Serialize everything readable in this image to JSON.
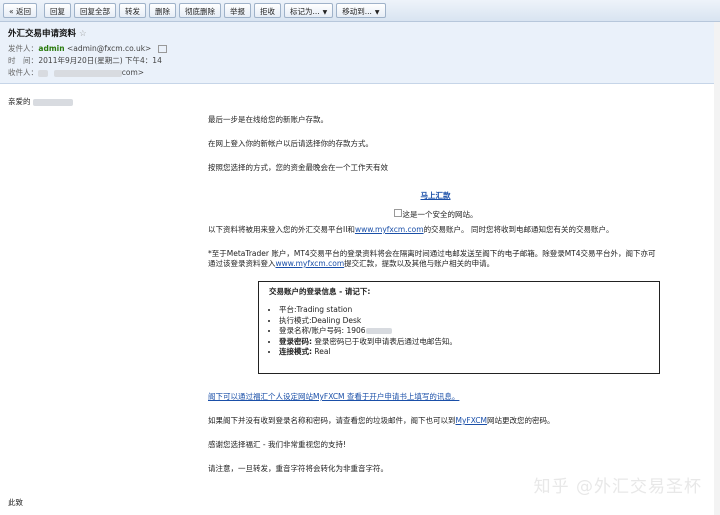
{
  "toolbar": {
    "back": "« 返回",
    "reply": "回复",
    "reply_all": "回复全部",
    "forward": "转发",
    "delete": "删除",
    "delete_perm": "彻底删除",
    "report": "举报",
    "reject": "拒收",
    "mark_as": "标记为...",
    "move_to": "移动到..."
  },
  "email": {
    "subject": "外汇交易申请资料",
    "labels": {
      "from": "发件人：",
      "time": "时　间：",
      "to": "收件人："
    },
    "from_name": "admin",
    "from_addr": "<admin@fxcm.co.uk>",
    "time": "2011年9月20日(星期二) 下午4：14",
    "to_suffix": "com>"
  },
  "body": {
    "greeting": "亲爱的",
    "p1": "最后一步是在线给您的新账户存款。",
    "p2": "在网上登入你的新帐户以后请选择你的存款方式。",
    "p3": "按照您选择的方式，您的资金最晚会在一个工作天有效",
    "deposit_link": "马上汇款",
    "secure_img_alt": "这是一个安全的网站。",
    "p4_a": "以下资料将被用来登入您的外汇交易平台II和",
    "p4_link": "www.myfxcm.com",
    "p4_b": "的交易账户。 同时您将收到电邮通知您有关的交易账户。",
    "p5_a": "*至于MetaTrader 账户，MT4交易平台的登录资料将会在隔离时间通过电邮发送至阁下的电子邮箱。除登录MT4交易平台外，阁下亦可通过该登录资料登入",
    "p5_link": "www.myfxcm.com",
    "p5_b": "提交汇款，提款以及其他与账户相关的申请。",
    "box_title": "交易账户的登录信息 - 请记下:",
    "box_items": [
      {
        "label": "平台:",
        "value": "Trading station",
        "bold": false
      },
      {
        "label": "执行模式:",
        "value": "Dealing Desk",
        "bold": false
      },
      {
        "label": "登录名称/账户号码: ",
        "value": "1906",
        "bold": false
      },
      {
        "label": "登录密码:",
        "value": " 登录密码已于收到申请表后通过电邮告知。",
        "bold": true
      },
      {
        "label": "连接模式:",
        "value": " Real",
        "bold": true
      }
    ],
    "p6_link": "阁下可以通过福汇个人设定网站MyFXCM 查看于开户申请书上填写的讯息。",
    "p7_a": "如果阁下并没有收到登录名称和密码，请查看您的垃圾邮件，阁下也可以到",
    "p7_link": "MyFXCM",
    "p7_b": "网站更改您的密码。",
    "p8": "感谢您选择福汇 - 我们非常重视您的支持!",
    "p9": "请注意，一旦转发，重音字符将会转化为非重音字符。",
    "closing": "此致"
  },
  "watermark": "知乎 @外汇交易圣杯"
}
